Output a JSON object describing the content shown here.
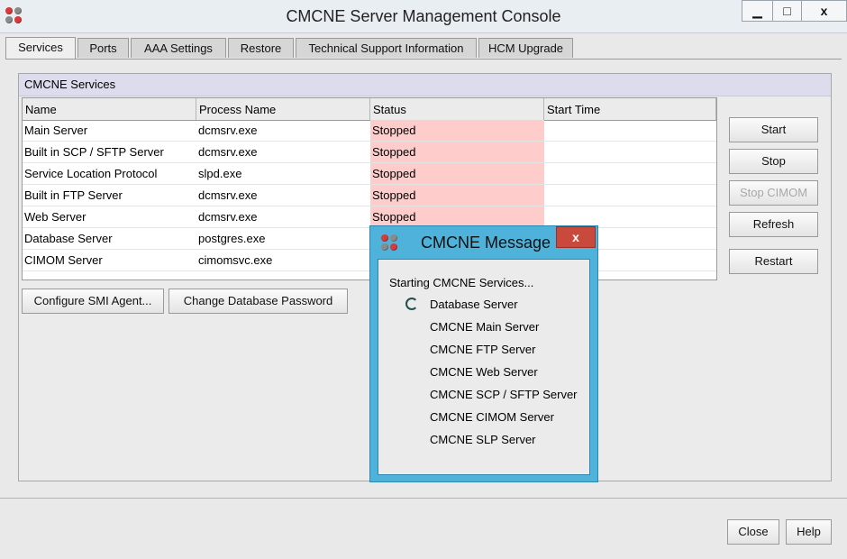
{
  "window": {
    "title": "CMCNE Server Management Console",
    "minimize": "▁",
    "maximize": "□",
    "close": "x"
  },
  "tabs": [
    {
      "label": "Services"
    },
    {
      "label": "Ports"
    },
    {
      "label": "AAA Settings"
    },
    {
      "label": "Restore"
    },
    {
      "label": "Technical Support Information"
    },
    {
      "label": "HCM Upgrade"
    }
  ],
  "panel": {
    "title": "CMCNE Services"
  },
  "table": {
    "headers": [
      "Name",
      "Process Name",
      "Status",
      "Start Time"
    ],
    "rows": [
      {
        "name": "Main Server",
        "process": "dcmsrv.exe",
        "status": "Stopped",
        "start": ""
      },
      {
        "name": "Built in SCP / SFTP Server",
        "process": "dcmsrv.exe",
        "status": "Stopped",
        "start": ""
      },
      {
        "name": "Service Location Protocol",
        "process": "slpd.exe",
        "status": "Stopped",
        "start": ""
      },
      {
        "name": "Built in FTP Server",
        "process": "dcmsrv.exe",
        "status": "Stopped",
        "start": ""
      },
      {
        "name": "Web Server",
        "process": "dcmsrv.exe",
        "status": "Stopped",
        "start": ""
      },
      {
        "name": "Database Server",
        "process": "postgres.exe",
        "status": "",
        "start": ""
      },
      {
        "name": "CIMOM Server",
        "process": "cimomsvc.exe",
        "status": "",
        "start": ""
      }
    ]
  },
  "side_buttons": {
    "start": "Start",
    "stop": "Stop",
    "stop_cimom": "Stop CIMOM",
    "refresh": "Refresh",
    "restart": "Restart"
  },
  "buttons": {
    "configure_smi": "Configure SMI Agent...",
    "change_db_password": "Change Database Password",
    "close": "Close",
    "help": "Help"
  },
  "dialog": {
    "title": "CMCNE Message",
    "close": "x",
    "heading": "Starting CMCNE Services...",
    "items": [
      "Database Server",
      "CMCNE Main Server",
      "CMCNE FTP Server",
      "CMCNE Web Server",
      "CMCNE SCP / SFTP Server",
      "CMCNE CIMOM Server",
      "CMCNE SLP Server"
    ]
  },
  "colors": {
    "stopped_status_bg": "#ffcccc",
    "dialog_frame": "#4fb2db",
    "dialog_close": "#c94a3c",
    "panel_header": "#dcdcec"
  },
  "icons": [
    "app-icon",
    "dialog-app-icon",
    "loading-spinner-icon"
  ]
}
